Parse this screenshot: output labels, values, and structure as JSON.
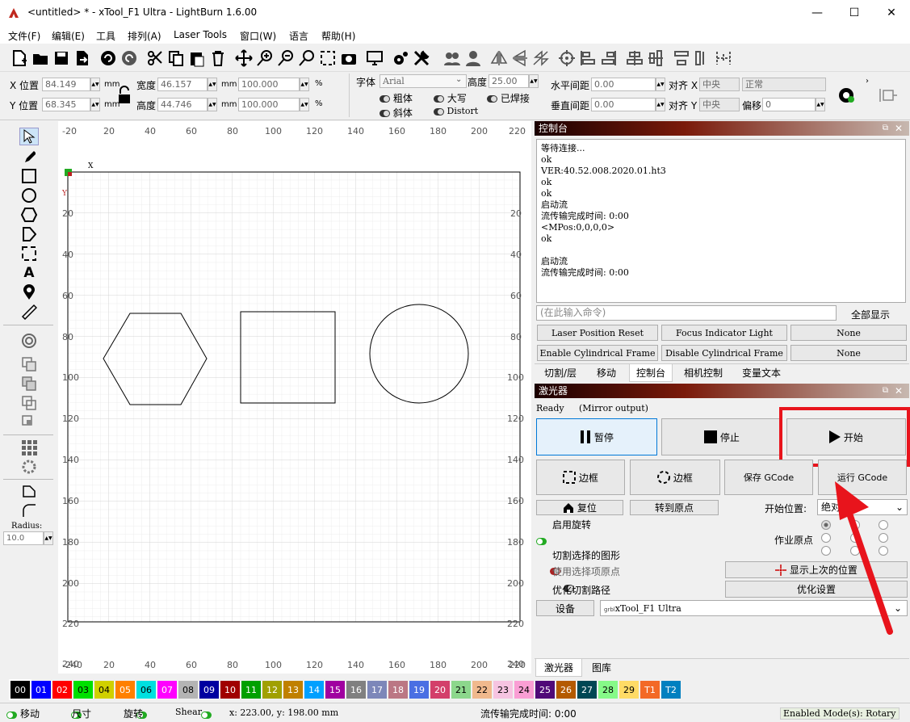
{
  "window": {
    "title": "<untitled> * - xTool_F1 Ultra - LightBurn 1.6.00"
  },
  "menu": [
    "文件(F)",
    "编辑(E)",
    "工具",
    "排列(A)",
    "Laser Tools",
    "窗口(W)",
    "语言",
    "帮助(H)"
  ],
  "props": {
    "x_label": "X 位置",
    "x_value": "84.149",
    "y_label": "Y 位置",
    "y_value": "68.345",
    "unit": "mm",
    "width_label": "宽度",
    "width_value": "46.157",
    "height_label": "高度",
    "height_value": "44.746",
    "scale_w": "100.000",
    "scale_h": "100.000",
    "percent": "%",
    "font_label": "字体",
    "font_value": "Arial",
    "text_height_label": "高度",
    "text_height_value": "25.00",
    "bold": "粗体",
    "italic": "斜体",
    "caps": "大写",
    "distort": "Distort",
    "welded": "已焊接",
    "hspace_label": "水平间距",
    "hspace_value": "0.00",
    "vspace_label": "垂直间距",
    "vspace_value": "0.00",
    "alignx_label": "对齐 X",
    "alignx_value": "中央",
    "aligny_label": "对齐 Y",
    "aligny_value": "中央",
    "style_value": "正常",
    "offset_label": "偏移",
    "offset_value": "0"
  },
  "tools": {
    "radius_label": "Radius:",
    "radius_value": "10.0"
  },
  "canvas": {
    "ruler_top": [
      "-20",
      "20",
      "40",
      "60",
      "80",
      "100",
      "120",
      "140",
      "160",
      "180",
      "200",
      "220"
    ],
    "ruler_left": [
      "20",
      "40",
      "60",
      "80",
      "100",
      "120",
      "140",
      "160",
      "180",
      "200",
      "220",
      "240"
    ],
    "ruler_bottom": [
      "-240",
      "20",
      "40",
      "60",
      "80",
      "100",
      "120",
      "140",
      "160",
      "180",
      "200",
      "220"
    ],
    "x_marker": "X",
    "y_marker": "Y"
  },
  "console": {
    "title": "控制台",
    "log": [
      "等待连接...",
      "ok",
      "VER:40.52.008.2020.01.ht3",
      "ok",
      "ok",
      "启动流",
      "流传输完成时间: 0:00",
      "<MPos:0,0,0,0>",
      "ok",
      "",
      "启动流",
      "流传输完成时间: 0:00"
    ],
    "cmd_placeholder": "(在此输入命令)",
    "show_all": "全部显示",
    "macros": [
      "Laser Position Reset",
      "Focus Indicator Light",
      "None",
      "Enable Cylindrical Frame",
      "Disable Cylindrical Frame",
      "None"
    ],
    "tabs": [
      "切割/层",
      "移动",
      "控制台",
      "相机控制",
      "变量文本"
    ]
  },
  "laser": {
    "title": "激光器",
    "status": "Ready",
    "status_note": "(Mirror output)",
    "pause": "暂停",
    "stop": "停止",
    "start": "开始",
    "frame1": "边框",
    "frame2": "边框",
    "save_gcode": "保存 GCode",
    "run_gcode": "运行 GCode",
    "home": "复位",
    "goto_origin": "转到原点",
    "start_from_label": "开始位置:",
    "start_from_value": "绝对坐标",
    "enable_rotary": "启用旋转",
    "job_origin": "作业原点",
    "cut_selected": "切割选择的图形",
    "use_selection_origin": "使用选择项原点",
    "optimize_path": "优化切割路径",
    "show_last_pos": "显示上次的位置",
    "optimize_settings": "优化设置",
    "device_label": "设备",
    "device_value": "xTool_F1 Ultra",
    "device_prefix": "grbl",
    "tabs": [
      "激光器",
      "图库"
    ]
  },
  "palette": [
    "00",
    "01",
    "02",
    "03",
    "04",
    "05",
    "06",
    "07",
    "08",
    "09",
    "10",
    "11",
    "12",
    "13",
    "14",
    "15",
    "16",
    "17",
    "18",
    "19",
    "20",
    "21",
    "22",
    "23",
    "24",
    "25",
    "26",
    "27",
    "28",
    "29",
    "T1",
    "T2"
  ],
  "palette_colors": [
    "#000000",
    "#0000ff",
    "#ff0000",
    "#00e000",
    "#d0d000",
    "#ff8000",
    "#00e0e0",
    "#ff00ff",
    "#b4b4b4",
    "#0000a0",
    "#a00000",
    "#00a000",
    "#a0a000",
    "#c08000",
    "#00a0ff",
    "#a000a0",
    "#808080",
    "#7d87b9",
    "#bb7784",
    "#4a6fe3",
    "#d33f6a",
    "#8cd78c",
    "#f0b98d",
    "#f6c4e1",
    "#fa9ed4",
    "#500a78",
    "#b45a00",
    "#004754",
    "#86fa88",
    "#ffdb66",
    "#f36926",
    "#0080c0"
  ],
  "statusbar": {
    "move": "移动",
    "size": "尺寸",
    "rotate": "旋转",
    "shear": "Shear",
    "coords": "x: 223.00, y: 198.00 mm",
    "stream": "流传输完成时间: 0:00",
    "mode": "Enabled Mode(s): Rotary"
  },
  "colors": {
    "highlight": "#e8141c",
    "accent_selected": "#cce4f7"
  }
}
